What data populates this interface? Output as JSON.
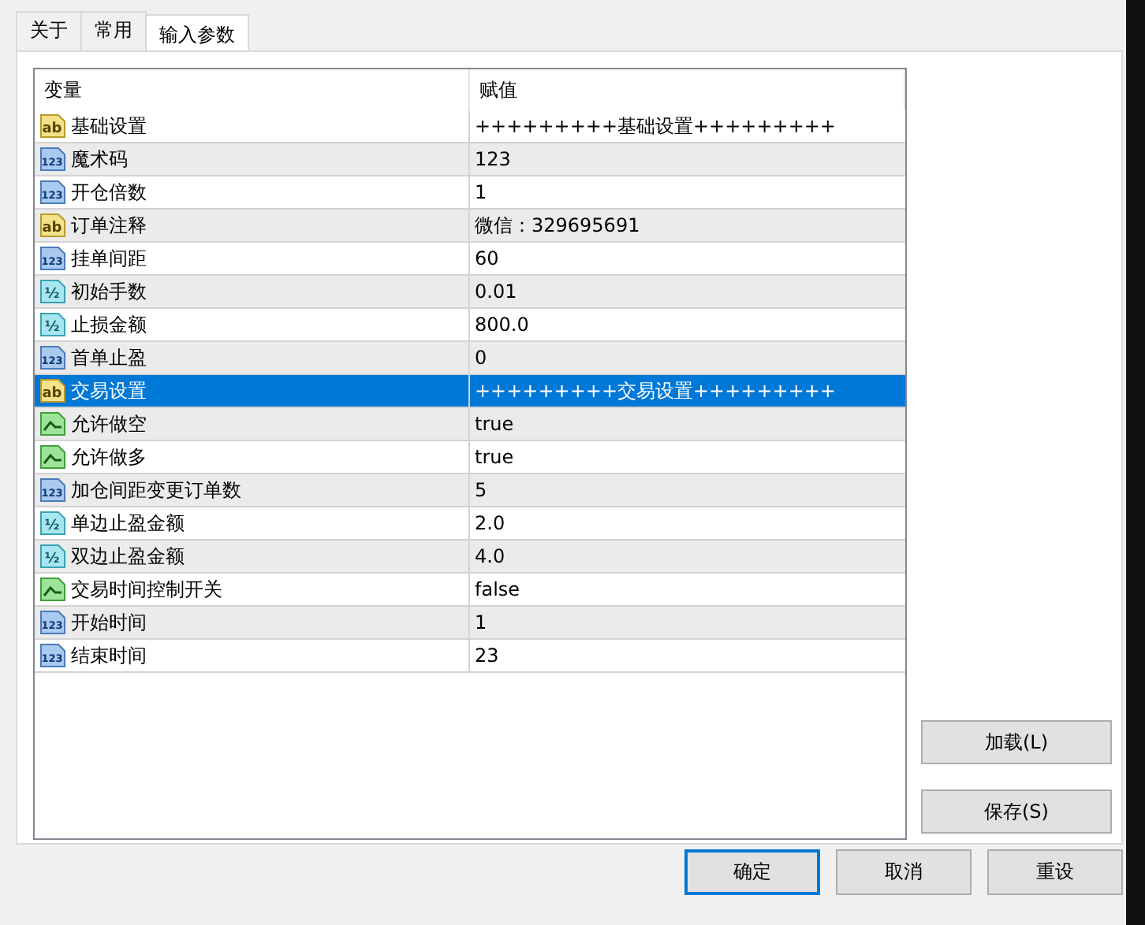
{
  "tabs": [
    {
      "label": "关于",
      "selected": false
    },
    {
      "label": "常用",
      "selected": false
    },
    {
      "label": "输入参数",
      "selected": true
    }
  ],
  "table": {
    "columns": [
      "变量",
      "赋值"
    ],
    "rows": [
      {
        "kind": "string",
        "icon_label": "ab",
        "name": "基础设置",
        "value": "+++++++++基础设置+++++++++",
        "selected": false
      },
      {
        "kind": "int",
        "icon_label": "123",
        "name": "魔术码",
        "value": "123",
        "selected": false
      },
      {
        "kind": "int",
        "icon_label": "123",
        "name": "开仓倍数",
        "value": "1",
        "selected": false
      },
      {
        "kind": "string",
        "icon_label": "ab",
        "name": "订单注释",
        "value": "微信：329695691",
        "selected": false
      },
      {
        "kind": "int",
        "icon_label": "123",
        "name": "挂单间距",
        "value": "60",
        "selected": false
      },
      {
        "kind": "double",
        "icon_label": "½",
        "name": "初始手数",
        "value": "0.01",
        "selected": false
      },
      {
        "kind": "double",
        "icon_label": "½",
        "name": "止损金额",
        "value": "800.0",
        "selected": false
      },
      {
        "kind": "int",
        "icon_label": "123",
        "name": "首单止盈",
        "value": "0",
        "selected": false
      },
      {
        "kind": "string",
        "icon_label": "ab",
        "name": "交易设置",
        "value": "+++++++++交易设置+++++++++",
        "selected": true
      },
      {
        "kind": "bool",
        "name": "允许做空",
        "value": "true",
        "selected": false
      },
      {
        "kind": "bool",
        "name": "允许做多",
        "value": "true",
        "selected": false
      },
      {
        "kind": "int",
        "icon_label": "123",
        "name": "加仓间距变更订单数",
        "value": "5",
        "selected": false
      },
      {
        "kind": "double",
        "icon_label": "½",
        "name": "单边止盈金额",
        "value": "2.0",
        "selected": false
      },
      {
        "kind": "double",
        "icon_label": "½",
        "name": "双边止盈金额",
        "value": "4.0",
        "selected": false
      },
      {
        "kind": "bool",
        "name": "交易时间控制开关",
        "value": "false",
        "selected": false
      },
      {
        "kind": "int",
        "icon_label": "123",
        "name": "开始时间",
        "value": "1",
        "selected": false
      },
      {
        "kind": "int",
        "icon_label": "123",
        "name": "结束时间",
        "value": "23",
        "selected": false
      }
    ]
  },
  "side_buttons": [
    "加载(L)",
    "保存(S)"
  ],
  "buttons": [
    {
      "label": "确定",
      "default": true
    },
    {
      "label": "取消",
      "default": false
    },
    {
      "label": "重设",
      "default": false
    }
  ]
}
